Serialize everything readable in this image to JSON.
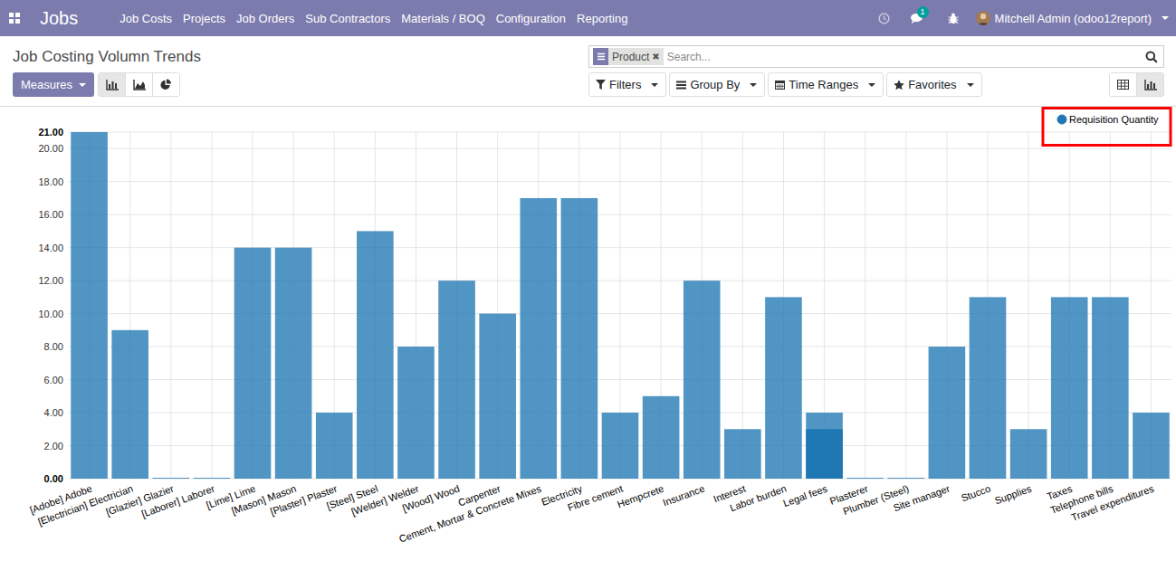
{
  "navbar": {
    "brand": "Jobs",
    "menu": [
      "Job Costs",
      "Projects",
      "Job Orders",
      "Sub Contractors",
      "Materials / BOQ",
      "Configuration",
      "Reporting"
    ],
    "chat_badge": "1",
    "user": "Mitchell Admin (odoo12report)"
  },
  "control_panel": {
    "title": "Job Costing Volumn Trends",
    "search": {
      "facets": [
        {
          "label": "Product",
          "remove": "✖"
        }
      ],
      "placeholder": "Search..."
    },
    "measures": "Measures",
    "chart_types": [
      {
        "kind": "bar",
        "selected": true
      },
      {
        "kind": "line",
        "selected": false
      },
      {
        "kind": "pie",
        "selected": false
      }
    ],
    "filter_buttons": [
      {
        "label": "Filters",
        "kind": "filter"
      },
      {
        "label": "Group By",
        "kind": "groupby"
      },
      {
        "label": "Time Ranges",
        "kind": "calendar"
      },
      {
        "label": "Favorites",
        "kind": "star"
      }
    ],
    "views": [
      {
        "kind": "list",
        "selected": false
      },
      {
        "kind": "graph",
        "selected": true
      }
    ]
  },
  "chart": {
    "y_max": 21,
    "y_ticks": [
      {
        "label": "0.00",
        "value": 0
      },
      {
        "label": "2.00",
        "value": 2
      },
      {
        "label": "4.00",
        "value": 4
      },
      {
        "label": "6.00",
        "value": 6
      },
      {
        "label": "8.00",
        "value": 8
      },
      {
        "label": "10.00",
        "value": 10
      },
      {
        "label": "12.00",
        "value": 12
      },
      {
        "label": "14.00",
        "value": 14
      },
      {
        "label": "16.00",
        "value": 16
      },
      {
        "label": "18.00",
        "value": 18
      },
      {
        "label": "20.00",
        "value": 20
      },
      {
        "label": "21.00",
        "value": 21
      }
    ],
    "categories": [
      "[Adobe] Adobe",
      "[Electrician] Electrician",
      "[Glazier] Glazier",
      "[Laborer] Laborer",
      "[Lime] Lime",
      "[Mason] Mason",
      "[Plaster] Plaster",
      "[Steel] Steel",
      "[Welder] Welder",
      "[Wood] Wood",
      "Carpenter",
      "Cement, Mortar & Concrete Mixes",
      "Electricity",
      "Fibre cement",
      "Hempcrete",
      "Insurance",
      "Interest",
      "Labor burden",
      "Legal fees",
      "Plasterer",
      "Plumber (Steel)",
      "Site manager",
      "Stucco",
      "Supplies",
      "Taxes",
      "Telephone bills",
      "Travel expenditures"
    ],
    "series": [
      {
        "name": "Requisition Quantity",
        "color": "#1f77b4",
        "values": [
          21,
          9,
          0,
          0,
          14,
          14,
          4,
          15,
          8,
          12,
          10,
          17,
          17,
          4,
          5,
          12,
          3,
          11,
          4,
          0,
          0,
          8,
          11,
          3,
          11,
          11,
          4
        ]
      }
    ],
    "legend": {
      "highlighted": true
    },
    "highlight": {
      "index": 18,
      "value": 3
    }
  }
}
